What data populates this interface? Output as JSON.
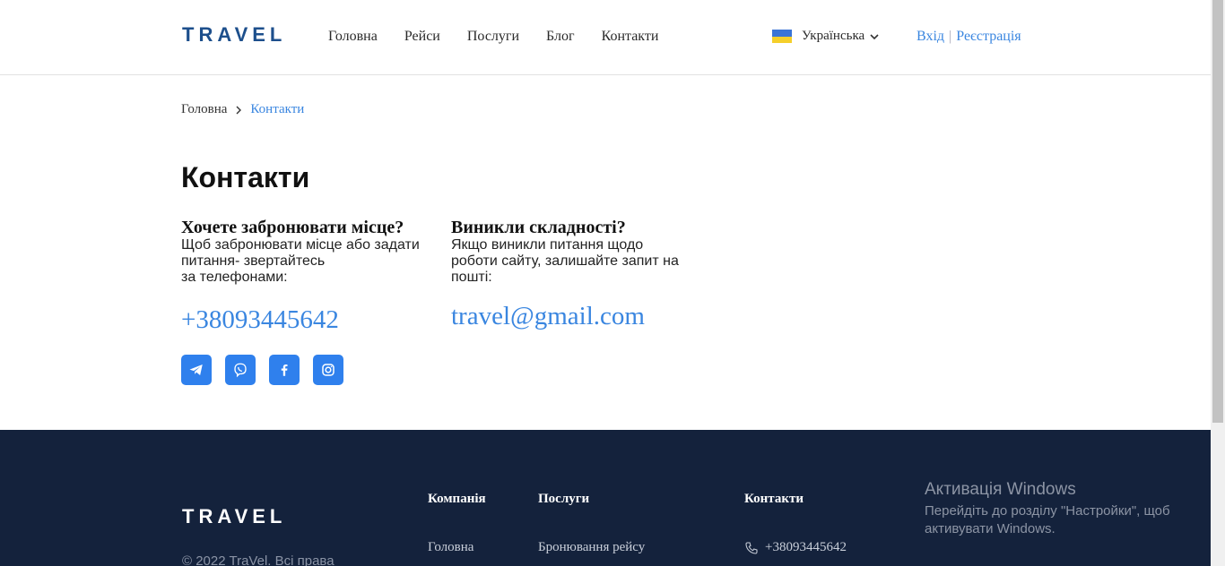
{
  "header": {
    "logo": "TRAVEL",
    "nav": [
      "Головна",
      "Рейси",
      "Послуги",
      "Блог",
      "Контакти"
    ],
    "language": "Українська",
    "login": "Вхід",
    "separator": "|",
    "register": "Реєстрація"
  },
  "breadcrumb": {
    "home": "Головна",
    "current": "Контакти"
  },
  "page_title": "Контакти",
  "booking": {
    "title": "Хочете забронювати місце?",
    "line1": "Щоб забронювати місце або задати",
    "line2": "питання- звертайтесь",
    "line3": "за телефонами:",
    "phone": "+38093445642"
  },
  "support": {
    "title": "Виникли складності?",
    "line1": "Якщо виникли питання щодо",
    "line2": "роботи сайту, залишайте запит на",
    "line3": "пошті:",
    "email": "travel@gmail.com"
  },
  "socials": [
    "telegram-icon",
    "viber-icon",
    "facebook-icon",
    "instagram-icon"
  ],
  "footer": {
    "logo": "TRAVEL",
    "copyright": "© 2022 TraVel. Всі права",
    "company_heading": "Компанія",
    "company_link": "Головна",
    "services_heading": "Послуги",
    "services_link": "Бронювання рейсу",
    "contacts_heading": "Контакти",
    "contacts_phone": "+38093445642"
  },
  "windows_activation": {
    "title": "Активація Windows",
    "line1": "Перейдіть до розділу \"Настройки\", щоб",
    "line2": "активувати Windows."
  },
  "colors": {
    "brand": "#1d4f8c",
    "accent": "#3a86e0",
    "social_bg": "#2f80ed",
    "footer_bg": "#14223c"
  }
}
